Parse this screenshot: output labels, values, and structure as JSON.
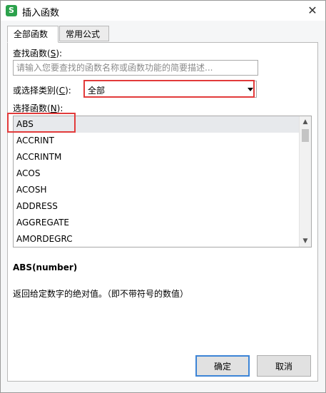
{
  "window": {
    "title": "插入函数",
    "app_icon_glyph": "S",
    "close_glyph": "✕"
  },
  "tabs": [
    {
      "label": "全部函数",
      "active": true
    },
    {
      "label": "常用公式",
      "active": false
    }
  ],
  "search": {
    "label": "查找函数(",
    "label_key": "S",
    "label_end": "):",
    "placeholder": "请输入您要查找的函数名称或函数功能的简要描述..."
  },
  "category": {
    "label": "或选择类别(",
    "label_key": "C",
    "label_end": "):",
    "selected": "全部"
  },
  "function_list": {
    "label": "选择函数(",
    "label_key": "N",
    "label_end": "):",
    "items": [
      "ABS",
      "ACCRINT",
      "ACCRINTM",
      "ACOS",
      "ACOSH",
      "ADDRESS",
      "AGGREGATE",
      "AMORDEGRC"
    ],
    "selected_index": 0
  },
  "details": {
    "signature": "ABS(number)",
    "description": "返回给定数字的绝对值。（即不带符号的数值）"
  },
  "buttons": {
    "ok": "确定",
    "cancel": "取消"
  },
  "colors": {
    "highlight_box": "#e23b3b",
    "app_icon": "#2ca24c",
    "default_button_border": "#3c84d6"
  }
}
